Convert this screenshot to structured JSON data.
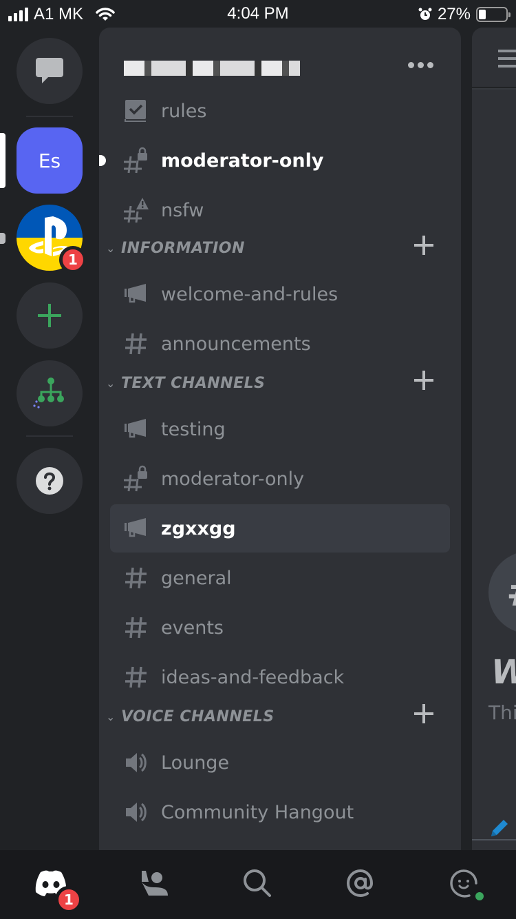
{
  "status_bar": {
    "carrier": "A1 MK",
    "time": "4:04 PM",
    "battery_percent": "27%",
    "battery_level": 0.27
  },
  "server_rail": {
    "servers": [
      {
        "name": "direct-messages",
        "icon": "chat-bubble-icon"
      },
      {
        "name": "Es",
        "initials": "Es",
        "active": true,
        "color": "#5865f2"
      },
      {
        "name": "playstation-server",
        "icon": "playstation-logo",
        "mentions": "1",
        "unread": true
      },
      {
        "name": "add-server",
        "icon": "plus-icon",
        "color": "#3ba55d"
      },
      {
        "name": "explore-servers",
        "icon": "hierarchy-icon",
        "color": "#3ba55d"
      },
      {
        "name": "help",
        "icon": "question-icon"
      }
    ]
  },
  "server": {
    "name_redacted": true,
    "more_icon": "ellipsis-icon"
  },
  "channels": {
    "uncategorized": [
      {
        "name": "rules",
        "type": "rules",
        "icon": "rules-checkbox-icon"
      },
      {
        "name": "moderator-only",
        "type": "text-locked",
        "icon": "hash-lock-icon",
        "unread": true
      },
      {
        "name": "nsfw",
        "type": "text-nsfw",
        "icon": "hash-warning-icon"
      }
    ],
    "categories": [
      {
        "name": "INFORMATION",
        "channels": [
          {
            "name": "welcome-and-rules",
            "type": "announcement",
            "icon": "megaphone-icon"
          },
          {
            "name": "announcements",
            "type": "text",
            "icon": "hash-icon"
          }
        ]
      },
      {
        "name": "TEXT CHANNELS",
        "channels": [
          {
            "name": "testing",
            "type": "announcement",
            "icon": "megaphone-icon"
          },
          {
            "name": "moderator-only",
            "type": "text-locked",
            "icon": "hash-lock-icon"
          },
          {
            "name": "zgxxgg",
            "type": "announcement",
            "icon": "megaphone-icon",
            "selected": true
          },
          {
            "name": "general",
            "type": "text",
            "icon": "hash-icon"
          },
          {
            "name": "events",
            "type": "text",
            "icon": "hash-icon"
          },
          {
            "name": "ideas-and-feedback",
            "type": "text",
            "icon": "hash-icon"
          }
        ]
      },
      {
        "name": "VOICE CHANNELS",
        "channels": [
          {
            "name": "Lounge",
            "type": "voice",
            "icon": "speaker-icon"
          },
          {
            "name": "Community Hangout",
            "type": "voice",
            "icon": "speaker-icon"
          }
        ]
      }
    ]
  },
  "chat_peek": {
    "welcome_title_partial": "W",
    "welcome_sub_partial": "Thi",
    "circle_glyph": "#"
  },
  "bottom_nav": {
    "items": [
      {
        "name": "home",
        "icon": "discord-logo-icon",
        "badge": "1",
        "active": true
      },
      {
        "name": "friends",
        "icon": "friends-wave-icon"
      },
      {
        "name": "search",
        "icon": "search-icon"
      },
      {
        "name": "mentions",
        "icon": "at-sign-icon"
      },
      {
        "name": "profile",
        "icon": "smiley-avatar-icon",
        "status": "online"
      }
    ]
  },
  "colors": {
    "blurple": "#5865f2",
    "green": "#3ba55d",
    "red_badge": "#ed4245",
    "panel": "#2f3136",
    "rail": "#202225",
    "selected": "#393c43"
  }
}
